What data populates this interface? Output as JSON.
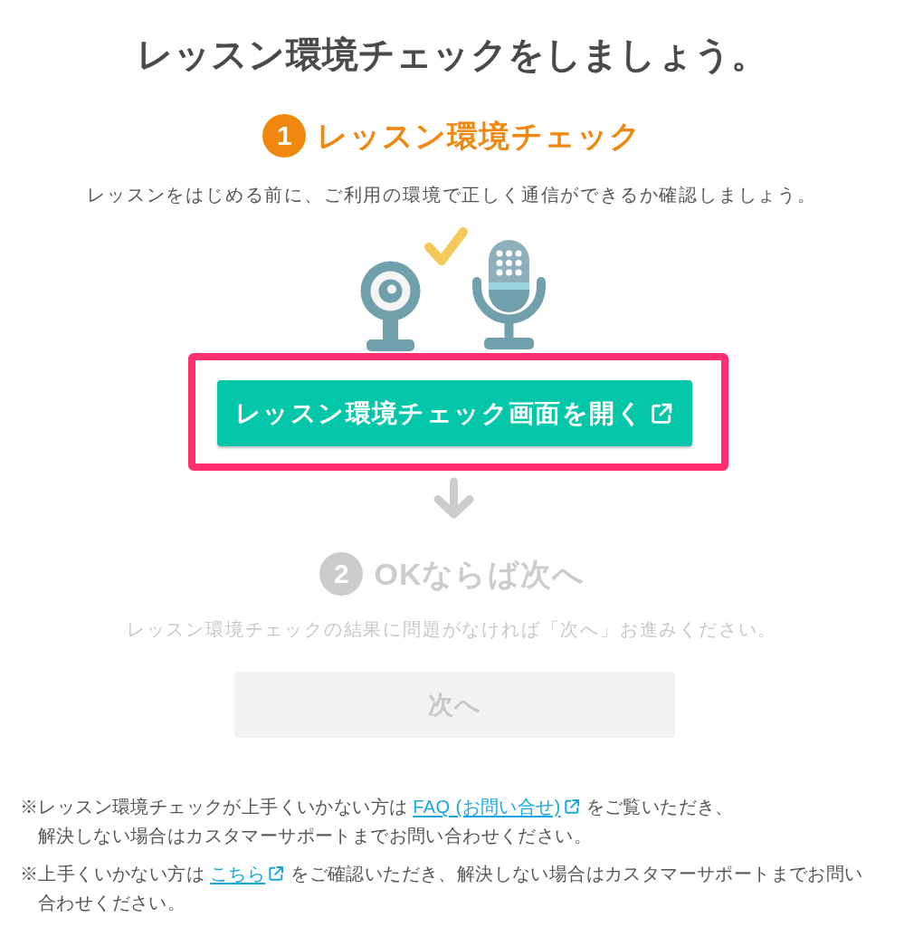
{
  "title": "レッスン環境チェックをしましょう。",
  "steps": [
    {
      "kind": "device_check",
      "number": "1",
      "heading": "レッスン環境チェック",
      "active": true,
      "description": "レッスンをはじめる前に、ご利用の環境で正しく通信ができるか確認しましょう。",
      "button": {
        "label": "レッスン環境チェック画面を開く",
        "disabled": false,
        "external": true,
        "highlighted": true
      }
    },
    {
      "kind": "proceed",
      "number": "2",
      "heading": "OKならば次へ",
      "active": false,
      "description": "レッスン環境チェックの結果に問題がなければ「次へ」お進みください。",
      "button": {
        "label": "次へ",
        "disabled": true
      }
    }
  ],
  "notes": [
    {
      "before": "※レッスン環境チェックが上手くいかない方は",
      "link": {
        "label": "FAQ (お問い合せ)",
        "external": true
      },
      "after": "をご覧いただき、",
      "continuation": "解決しない場合はカスタマーサポートまでお問い合わせください。"
    },
    {
      "before": "※上手くいかない方は",
      "link": {
        "label": "こちら",
        "external": true
      },
      "after": "をご確認いただき、解決しない場合はカスタマーサポートまでお問い合わせください。"
    }
  ]
}
